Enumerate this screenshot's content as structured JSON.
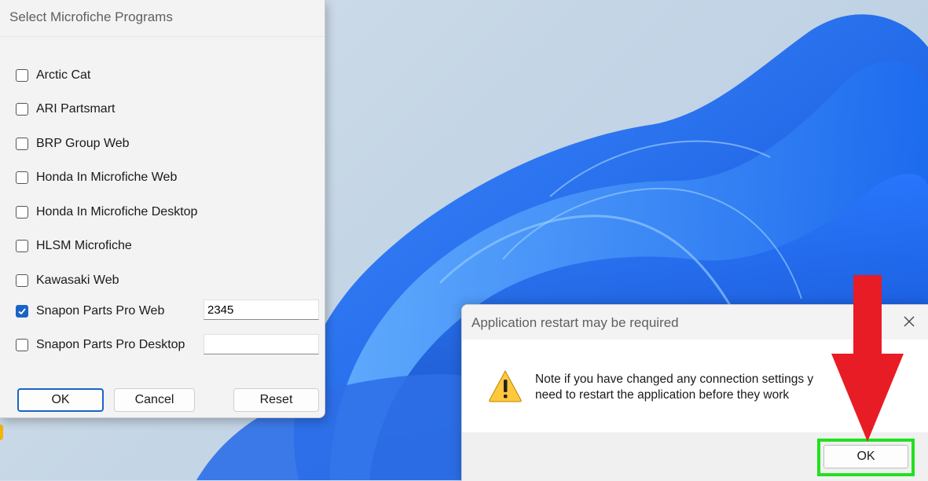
{
  "left_dialog": {
    "title": "Select Microfiche Programs",
    "programs": [
      {
        "label": "Arctic Cat",
        "checked": false
      },
      {
        "label": "ARI Partsmart",
        "checked": false
      },
      {
        "label": "BRP Group Web",
        "checked": false
      },
      {
        "label": "Honda In Microfiche Web",
        "checked": false
      },
      {
        "label": "Honda In Microfiche Desktop",
        "checked": false
      },
      {
        "label": "HLSM Microfiche",
        "checked": false
      },
      {
        "label": "Kawasaki Web",
        "checked": false
      },
      {
        "label": "Snapon Parts Pro Web",
        "checked": true,
        "field_value": "2345"
      },
      {
        "label": "Snapon Parts Pro Desktop",
        "checked": false,
        "field_value": ""
      }
    ],
    "buttons": {
      "ok": "OK",
      "cancel": "Cancel",
      "reset": "Reset"
    }
  },
  "right_dialog": {
    "title": "Application restart may be required",
    "message_line1": "Note if you have changed any connection settings y",
    "message_line2": "need to restart the application before they work",
    "ok_label": "OK",
    "icon": "warning-icon",
    "close_icon": "close-icon"
  },
  "annotation": {
    "arrow_color": "#e81c24",
    "highlight_color": "#22e01f"
  }
}
